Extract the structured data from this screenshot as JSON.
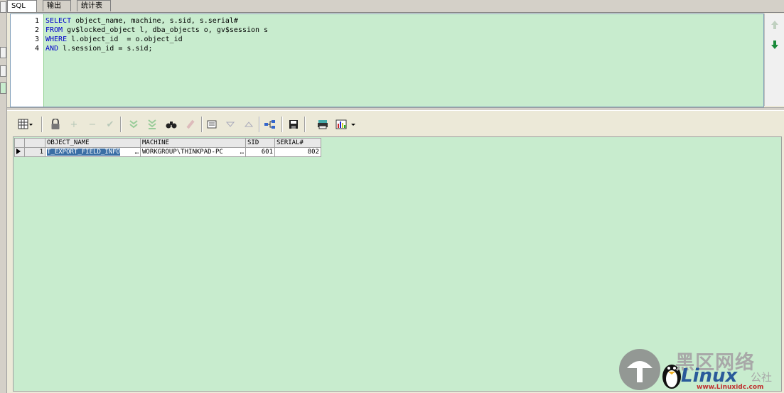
{
  "tabs": [
    {
      "label": "SQL"
    },
    {
      "label": "输出"
    },
    {
      "label": "统计表"
    }
  ],
  "editor": {
    "line_numbers": [
      "1",
      "2",
      "3",
      "4"
    ],
    "lines": [
      {
        "kw": "SELECT",
        "rest": " object_name, machine, s.sid, s.serial#"
      },
      {
        "kw": "FROM",
        "rest": " gv$locked_object l, dba_objects o, gv$session s"
      },
      {
        "kw": "WHERE",
        "rest": " l.object_id  = o.object_id"
      },
      {
        "kw": "AND",
        "rest": " l.session_id = s.sid;"
      }
    ]
  },
  "toolbar": {
    "icons": [
      "grid-menu-icon",
      "lock-icon",
      "add-record-icon",
      "delete-record-icon",
      "post-changes-icon",
      "fetch-next-icon",
      "fetch-last-icon",
      "find-icon",
      "clear-icon",
      "single-record-icon",
      "next-record-icon",
      "previous-record-icon",
      "query-by-example-icon",
      "export-icon",
      "print-icon",
      "chart-icon"
    ]
  },
  "grid": {
    "columns": [
      "OBJECT_NAME",
      "MACHINE",
      "SID",
      "SERIAL#"
    ],
    "rows": [
      {
        "row_number": "1",
        "object_name": "T_EXPORT_FIELD_INFO",
        "machine": "WORKGROUP\\THINKPAD-PC",
        "sid": "601",
        "serial": "802"
      }
    ]
  },
  "watermark": {
    "cn_text": "黑区网络",
    "brand": "Linux",
    "suffix": "公社",
    "url": "www.Linuxidc.com"
  },
  "colors": {
    "editor_bg": "#c8ecce",
    "keyword": "#0000cc",
    "selection": "#3a6ea5"
  }
}
